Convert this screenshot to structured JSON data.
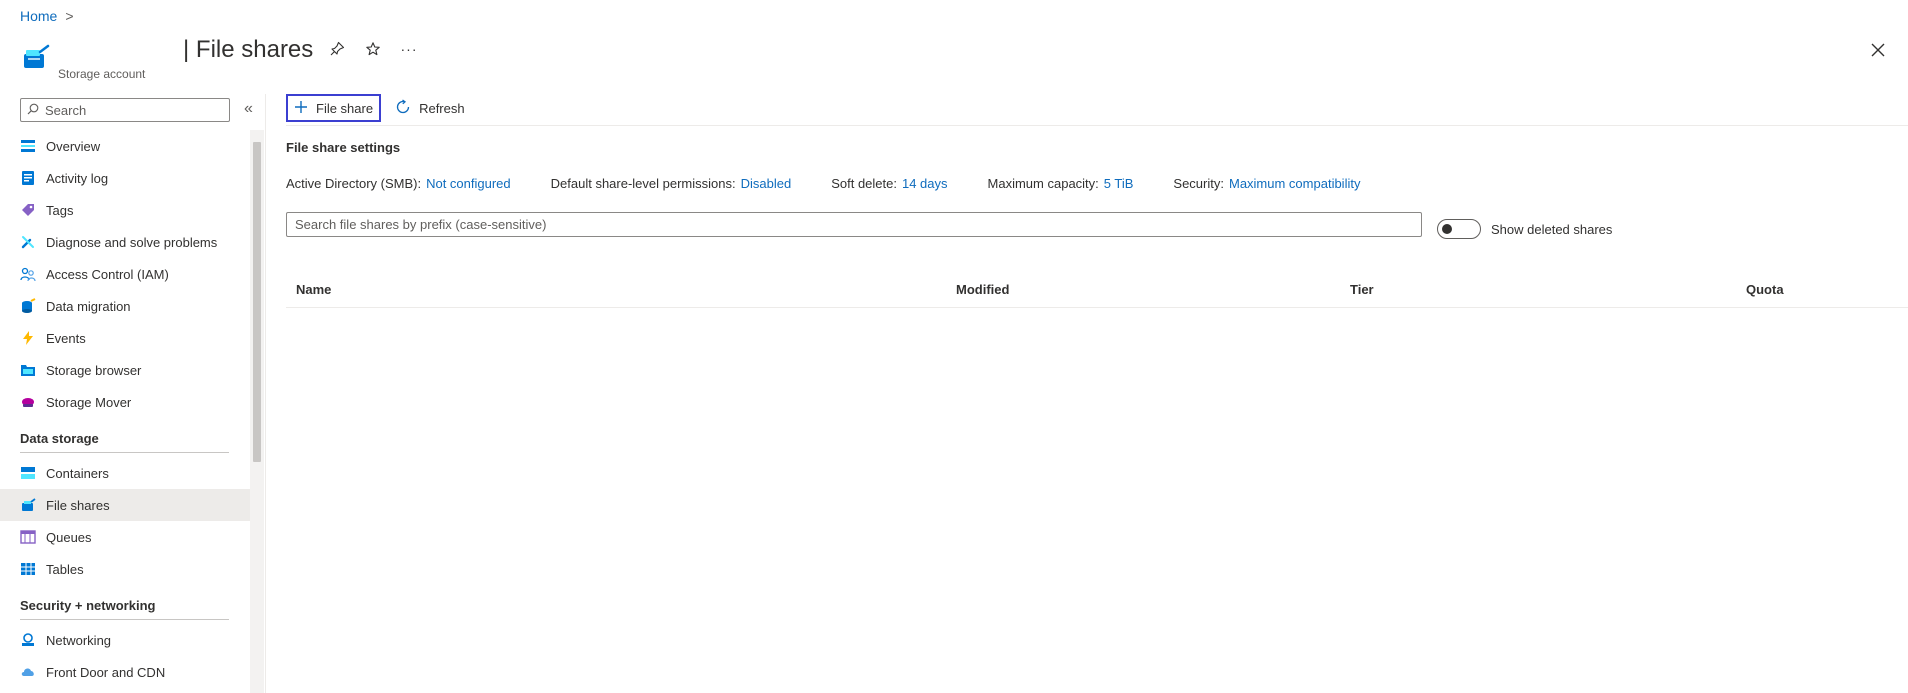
{
  "breadcrumb": {
    "home": "Home",
    "separator": ">"
  },
  "header": {
    "resource_type": "Storage account",
    "title": "| File shares",
    "pin_icon": "pin-icon",
    "favorite_icon": "star-icon",
    "more_label": "···"
  },
  "sidebar": {
    "search_placeholder": "Search",
    "collapse_label": "«",
    "items": [
      {
        "label": "Overview",
        "icon": "overview-icon"
      },
      {
        "label": "Activity log",
        "icon": "activity-log-icon"
      },
      {
        "label": "Tags",
        "icon": "tag-icon"
      },
      {
        "label": "Diagnose and solve problems",
        "icon": "wrench-icon"
      },
      {
        "label": "Access Control (IAM)",
        "icon": "people-icon"
      },
      {
        "label": "Data migration",
        "icon": "data-migration-icon"
      },
      {
        "label": "Events",
        "icon": "lightning-icon"
      },
      {
        "label": "Storage browser",
        "icon": "folder-icon"
      },
      {
        "label": "Storage Mover",
        "icon": "cloud-mover-icon"
      }
    ],
    "sections": [
      {
        "title": "Data storage",
        "items": [
          {
            "label": "Containers",
            "icon": "containers-icon"
          },
          {
            "label": "File shares",
            "icon": "file-share-icon",
            "selected": true
          },
          {
            "label": "Queues",
            "icon": "queue-icon"
          },
          {
            "label": "Tables",
            "icon": "table-icon"
          }
        ]
      },
      {
        "title": "Security + networking",
        "items": [
          {
            "label": "Networking",
            "icon": "networking-icon"
          },
          {
            "label": "Front Door and CDN",
            "icon": "cloud-cdn-icon"
          }
        ]
      }
    ]
  },
  "toolbar": {
    "add_label": "File share",
    "refresh_label": "Refresh"
  },
  "settings": {
    "title": "File share settings",
    "items": [
      {
        "label": "Active Directory (SMB):",
        "value": "Not configured"
      },
      {
        "label": "Default share-level permissions:",
        "value": "Disabled"
      },
      {
        "label": "Soft delete:",
        "value": "14 days"
      },
      {
        "label": "Maximum capacity:",
        "value": "5 TiB"
      },
      {
        "label": "Security:",
        "value": "Maximum compatibility"
      }
    ]
  },
  "filter": {
    "placeholder": "Search file shares by prefix (case-sensitive)",
    "value": ""
  },
  "toggle": {
    "label": "Show deleted shares",
    "on": false
  },
  "table": {
    "columns": [
      "Name",
      "Modified",
      "Tier",
      "Quota"
    ],
    "rows": []
  },
  "colors": {
    "accent": "#0f6cbd",
    "focus": "#3b3fd1",
    "selected_bg": "#edebe9"
  }
}
